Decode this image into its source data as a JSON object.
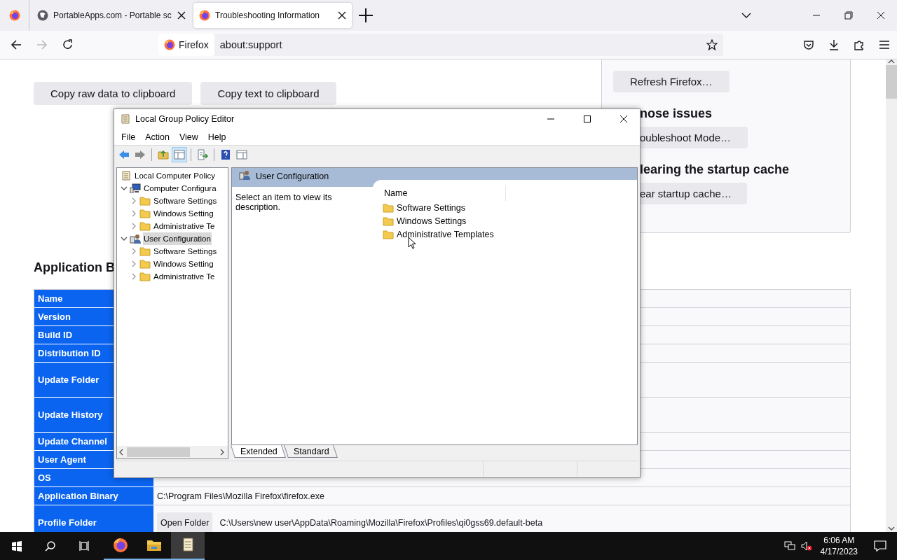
{
  "browser": {
    "tabs": [
      {
        "kind": "pinned",
        "selected": false
      },
      {
        "kind": "page",
        "title": "PortableApps.com - Portable sc",
        "selected": false
      },
      {
        "kind": "page",
        "title": "Troubleshooting Information",
        "selected": true
      }
    ],
    "nav_buttons": [
      {
        "kind": "back",
        "disabled": false
      },
      {
        "kind": "forward",
        "disabled": true
      },
      {
        "kind": "reload",
        "disabled": false
      }
    ],
    "address": {
      "identity": "Firefox",
      "url": "about:support"
    }
  },
  "page": {
    "top_buttons": [
      "Copy raw data to clipboard",
      "Copy text to clipboard"
    ],
    "side_box": [
      {
        "kind": "button",
        "text": "Refresh Firefox…"
      },
      {
        "kind": "heading",
        "text": "nose issues"
      },
      {
        "kind": "button",
        "text": "oubleshoot Mode…"
      },
      {
        "kind": "heading",
        "text": "learing the startup cache"
      },
      {
        "kind": "button",
        "text": "ear startup cache…"
      }
    ],
    "section_title": "Application B",
    "table": [
      {
        "label": "Name"
      },
      {
        "label": "Version"
      },
      {
        "label": "Build ID"
      },
      {
        "label": "Distribution ID"
      },
      {
        "label": "Update Folder"
      },
      {
        "label": "Update History"
      },
      {
        "label": "Update Channel"
      },
      {
        "label": "User Agent"
      },
      {
        "label": "OS"
      },
      {
        "label": "Application Binary",
        "value": "C:\\Program Files\\Mozilla Firefox\\firefox.exe"
      },
      {
        "label": "Profile Folder",
        "button": "Open Folder",
        "value": "C:\\Users\\new user\\AppData\\Roaming\\Mozilla\\Firefox\\Profiles\\qi0gss69.default-beta"
      }
    ]
  },
  "dialog": {
    "title": "Local Group Policy Editor",
    "menu": [
      "File",
      "Action",
      "View",
      "Help"
    ],
    "toolbar": [
      {
        "kind": "back",
        "pressed": false
      },
      {
        "kind": "forward",
        "pressed": false
      },
      {
        "kind": "up",
        "pressed": false
      },
      {
        "kind": "tree",
        "pressed": true
      },
      {
        "kind": "export",
        "pressed": false
      },
      {
        "kind": "help",
        "pressed": false
      },
      {
        "kind": "pane",
        "pressed": false
      }
    ],
    "tree": [
      {
        "label": "Local Computer Policy",
        "kind": "policy",
        "selected": false,
        "children": [
          {
            "label": "Computer Configura",
            "kind": "computer",
            "expanded": true,
            "selected": false,
            "children": [
              {
                "label": "Software Settings",
                "kind": "folder",
                "expanded": false,
                "selected": false
              },
              {
                "label": "Windows Setting",
                "kind": "folder",
                "expanded": false,
                "selected": false
              },
              {
                "label": "Administrative Te",
                "kind": "folder",
                "expanded": false,
                "selected": false
              }
            ]
          },
          {
            "label": "User Configuration",
            "kind": "user",
            "expanded": true,
            "selected": true,
            "children": [
              {
                "label": "Software Settings",
                "kind": "folder",
                "expanded": false,
                "selected": false
              },
              {
                "label": "Windows Setting",
                "kind": "folder",
                "expanded": false,
                "selected": false
              },
              {
                "label": "Administrative Te",
                "kind": "folder",
                "expanded": false,
                "selected": false
              }
            ]
          }
        ]
      }
    ],
    "detail": {
      "header": "User Configuration",
      "description": "Select an item to view its description.",
      "column": "Name",
      "items": [
        "Software Settings",
        "Windows Settings",
        "Administrative Templates"
      ]
    },
    "view_tabs": [
      {
        "label": "Extended",
        "selected": true
      },
      {
        "label": "Standard",
        "selected": false
      }
    ]
  },
  "taskbar": {
    "apps": [
      {
        "kind": "firefox",
        "active": false
      },
      {
        "kind": "explorer",
        "active": false
      },
      {
        "kind": "gpedit",
        "active": true
      }
    ],
    "time": "6:06 AM",
    "date": "4/17/2023"
  }
}
